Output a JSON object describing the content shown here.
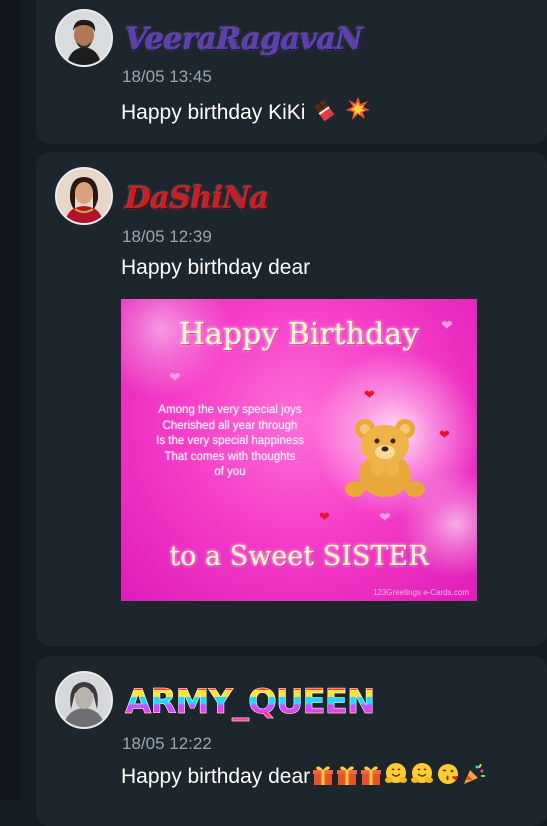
{
  "messages": [
    {
      "author": "VeeraRagavaN",
      "timestamp": "18/05 13:45",
      "text": "Happy birthday KiKi",
      "emojis": [
        "chocolate-bar-icon",
        "collision-icon"
      ]
    },
    {
      "author": "DaShiNa",
      "timestamp": "18/05 12:39",
      "text": "Happy birthday dear",
      "card": {
        "title": "Happy Birthday",
        "poem": [
          "Among the very special joys",
          "Cherished all year through",
          "Is the very special happiness",
          "That comes with thoughts",
          "of you"
        ],
        "footer": "to a Sweet SISTER",
        "credit": "123Greetings  e-Cards.com"
      }
    },
    {
      "author": "ARMY_QUEEN",
      "timestamp": "18/05 12:22",
      "text": "Happy birthday dear",
      "emojis": [
        "gift-icon",
        "gift-icon",
        "gift-icon",
        "hugging-face-icon",
        "hugging-face-icon",
        "kissing-face-icon",
        "party-popper-icon"
      ]
    }
  ],
  "colors": {
    "background": "#151c22",
    "card": "#1d262d",
    "timestamp": "#9aa6b0",
    "message_text": "#ffffff",
    "greeting_pink": "#f53ec9"
  }
}
